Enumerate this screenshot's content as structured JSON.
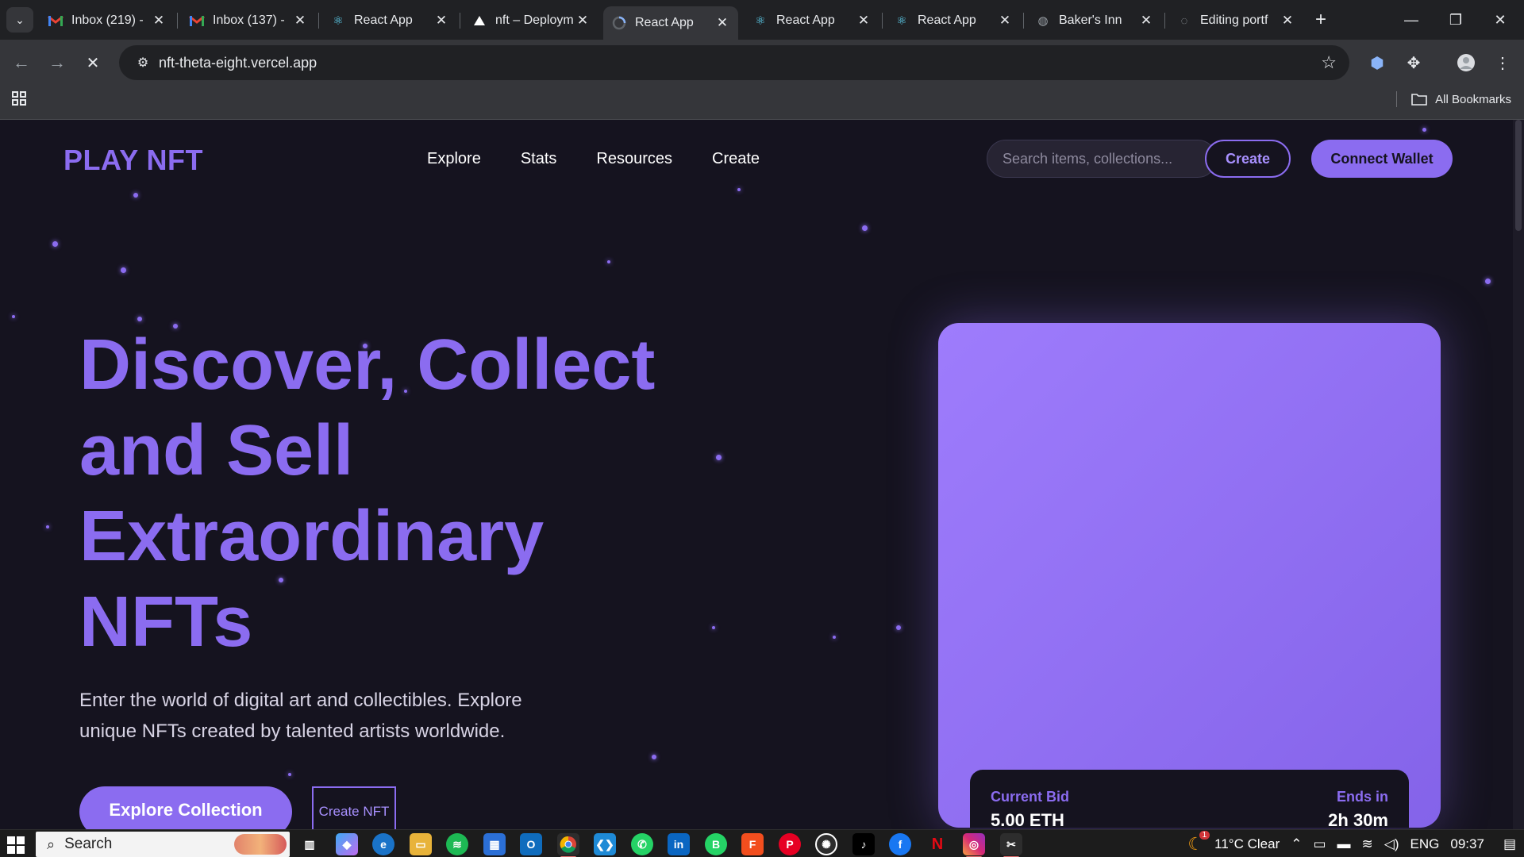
{
  "browser": {
    "tabs": [
      {
        "title": "Inbox (219) -",
        "icon": "gmail-icon",
        "active": false
      },
      {
        "title": "Inbox (137) -",
        "icon": "gmail-icon",
        "active": false
      },
      {
        "title": "React App",
        "icon": "react-icon",
        "active": false
      },
      {
        "title": "nft – Deploym",
        "icon": "vercel-icon",
        "active": false
      },
      {
        "title": "React App",
        "icon": "react-icon",
        "active": true
      },
      {
        "title": "React App",
        "icon": "react-icon",
        "active": false
      },
      {
        "title": "React App",
        "icon": "react-icon",
        "active": false
      },
      {
        "title": "Baker's Inn",
        "icon": "globe-icon",
        "active": false
      },
      {
        "title": "Editing portf",
        "icon": "github-icon",
        "active": false
      }
    ],
    "url": "nft-theta-eight.vercel.app",
    "bookmarks_label": "All Bookmarks"
  },
  "site": {
    "logo": "PLAY NFT",
    "nav": [
      "Explore",
      "Stats",
      "Resources",
      "Create"
    ],
    "search_placeholder": "Search items, collections...",
    "create_label": "Create",
    "wallet_label": "Connect Wallet",
    "hero_title": "Discover, Collect and Sell Extraordinary NFTs",
    "hero_subtitle": "Enter the world of digital art and collectibles. Explore unique NFTs created by talented artists worldwide.",
    "explore_label": "Explore Collection",
    "create_nft_label": "Create NFT",
    "card": {
      "bid_label": "Current Bid",
      "bid_value": "5.00 ETH",
      "ends_label": "Ends in",
      "ends_value": "2h 30m"
    },
    "accent_color": "#8b6cf0"
  },
  "taskbar": {
    "search_label": "Search",
    "weather": "11°C Clear",
    "weather_badge": "1",
    "lang": "ENG",
    "time": "09:37"
  }
}
